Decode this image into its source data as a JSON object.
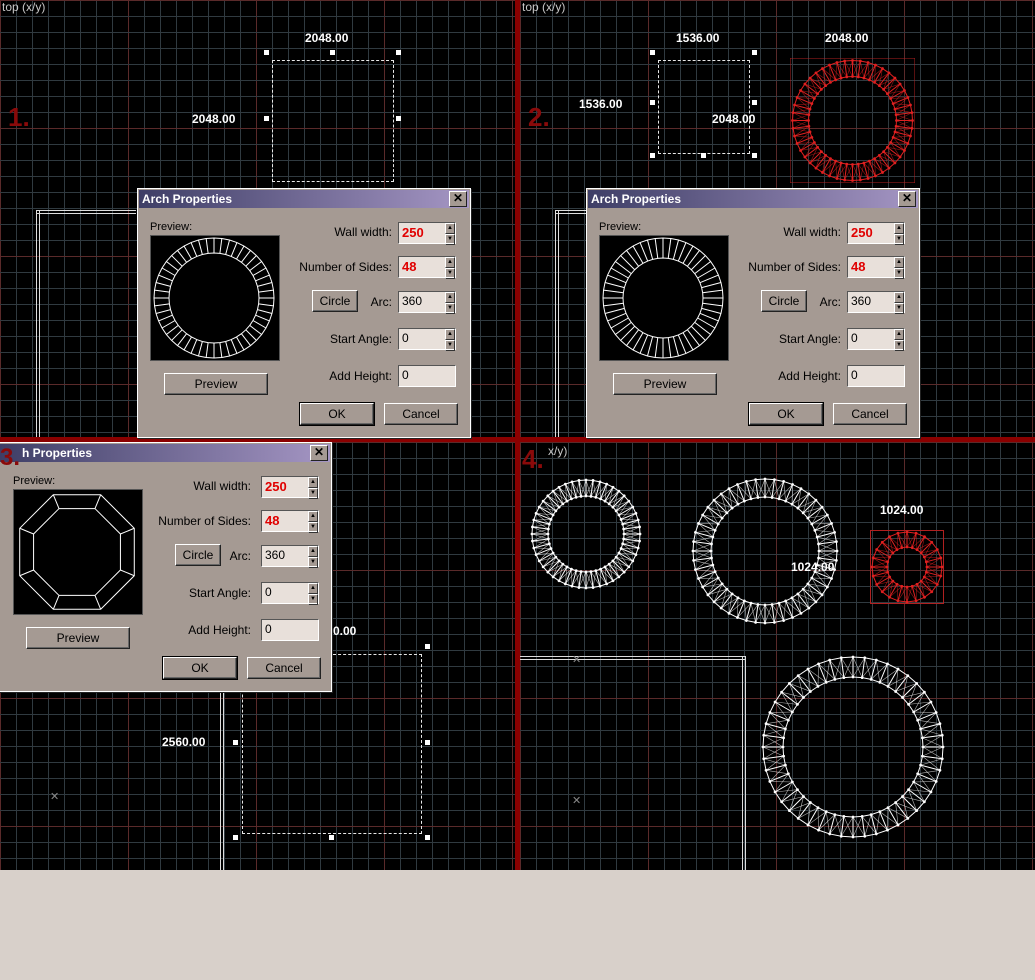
{
  "views": [
    {
      "label": "top (x/y)",
      "step": "1.",
      "dims": [
        "2048.00",
        "2048.00"
      ]
    },
    {
      "label": "top (x/y)",
      "step": "2.",
      "dims": [
        "1536.00",
        "1536.00",
        "2048.00",
        "2048.00"
      ]
    },
    {
      "label": "",
      "step": "3.",
      "dims": [
        "2560.00",
        "0.00"
      ]
    },
    {
      "label": "x/y)",
      "step": "4.",
      "dims": [
        "1024.00",
        "1024.00"
      ]
    }
  ],
  "dialog": {
    "title": "Arch Properties",
    "title_clipped": "h Properties",
    "close": "✕",
    "preview_label": "Preview:",
    "wall_width_label": "Wall width:",
    "wall_width": "250",
    "sides_label": "Number of Sides:",
    "sides": "48",
    "circle_btn": "Circle",
    "arc_label": "Arc:",
    "arc": "360",
    "start_angle_label": "Start Angle:",
    "start_angle": "0",
    "add_height_label": "Add Height:",
    "add_height": "0",
    "preview_btn": "Preview",
    "ok_btn": "OK",
    "cancel_btn": "Cancel"
  },
  "colors": {
    "grid_bg": "#000000",
    "grid_line": "#303a40",
    "grid_major": "#5a2a2a",
    "separator": "#8b0000",
    "selection": "#e02020"
  }
}
